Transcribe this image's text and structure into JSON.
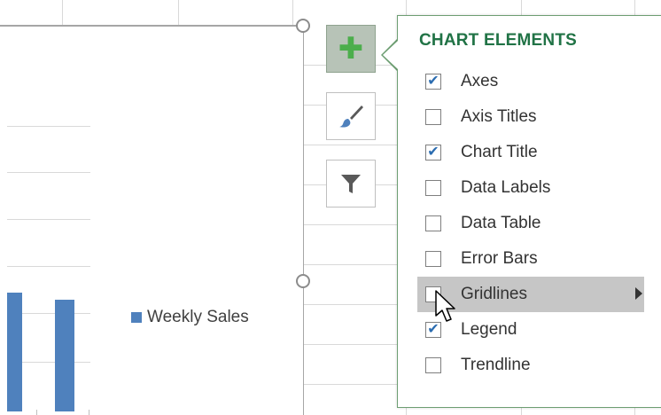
{
  "chart": {
    "legend_label": "Weekly Sales",
    "series_color": "#4f81bd"
  },
  "side_buttons": [
    {
      "name": "chart-elements",
      "icon": "plus-icon",
      "active": true
    },
    {
      "name": "chart-styles",
      "icon": "paintbrush-icon",
      "active": false
    },
    {
      "name": "chart-filters",
      "icon": "filter-icon",
      "active": false
    }
  ],
  "panel": {
    "title": "CHART ELEMENTS",
    "accent": "#217346",
    "items": [
      {
        "label": "Axes",
        "checked": true
      },
      {
        "label": "Axis Titles",
        "checked": false
      },
      {
        "label": "Chart Title",
        "checked": true
      },
      {
        "label": "Data Labels",
        "checked": false
      },
      {
        "label": "Data Table",
        "checked": false
      },
      {
        "label": "Error Bars",
        "checked": false
      },
      {
        "label": "Gridlines",
        "checked": false,
        "hover": true,
        "has_submenu": true
      },
      {
        "label": "Legend",
        "checked": true
      },
      {
        "label": "Trendline",
        "checked": false
      }
    ]
  }
}
